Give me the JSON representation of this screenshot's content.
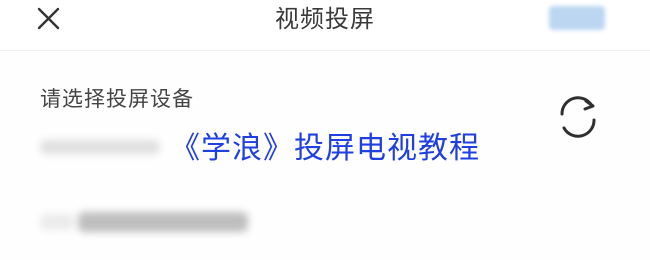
{
  "header": {
    "title": "视频投屏",
    "close_icon": "close-icon",
    "confirm_button_color": "#bcd6f1"
  },
  "main": {
    "section_label": "请选择投屏设备",
    "refresh_icon": "refresh-icon"
  },
  "overlay": {
    "caption": "《学浪》投屏电视教程",
    "caption_color": "#1f3fe0"
  }
}
